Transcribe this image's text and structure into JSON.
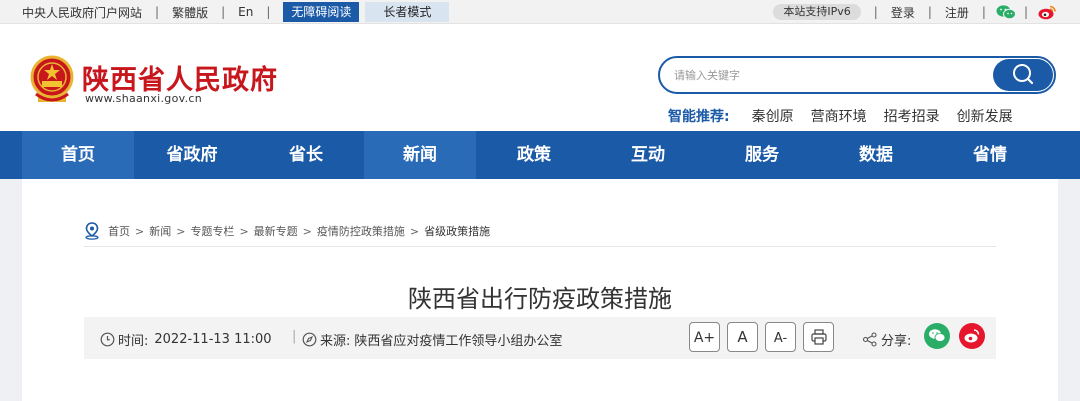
{
  "topbar": {
    "links": [
      "中央人民政府门户网站",
      "繁體版",
      "En"
    ],
    "accessible_reading": "无障碍阅读",
    "elder_mode": "长者模式",
    "ipv6": "本站支持IPv6",
    "login": "登录",
    "register": "注册"
  },
  "header": {
    "site_title": "陕西省人民政府",
    "site_url": "www.shaanxi.gov.cn",
    "search_placeholder": "请输入关键字",
    "recommend_label": "智能推荐:",
    "recommend_items": [
      "秦创原",
      "营商环境",
      "招考招录",
      "创新发展"
    ]
  },
  "nav": {
    "items": [
      "首页",
      "省政府",
      "省长",
      "新闻",
      "政策",
      "互动",
      "服务",
      "数据",
      "省情"
    ]
  },
  "breadcrumb": [
    "首页",
    "新闻",
    "专题专栏",
    "最新专题",
    "疫情防控政策措施",
    "省级政策措施"
  ],
  "article": {
    "title": "陕西省出行防疫政策措施",
    "time_label": "时间:",
    "time": "2022-11-13 11:00",
    "source_label": "来源:",
    "source": "陕西省应对疫情工作领导小组办公室",
    "font_larger": "A+",
    "font_normal": "A",
    "font_smaller": "A-",
    "share_label": "分享:"
  },
  "colors": {
    "primary_blue": "#1b5aa7",
    "brand_red": "#c8161d",
    "wechat_green": "#2aae67",
    "weibo_red": "#e6162d"
  }
}
